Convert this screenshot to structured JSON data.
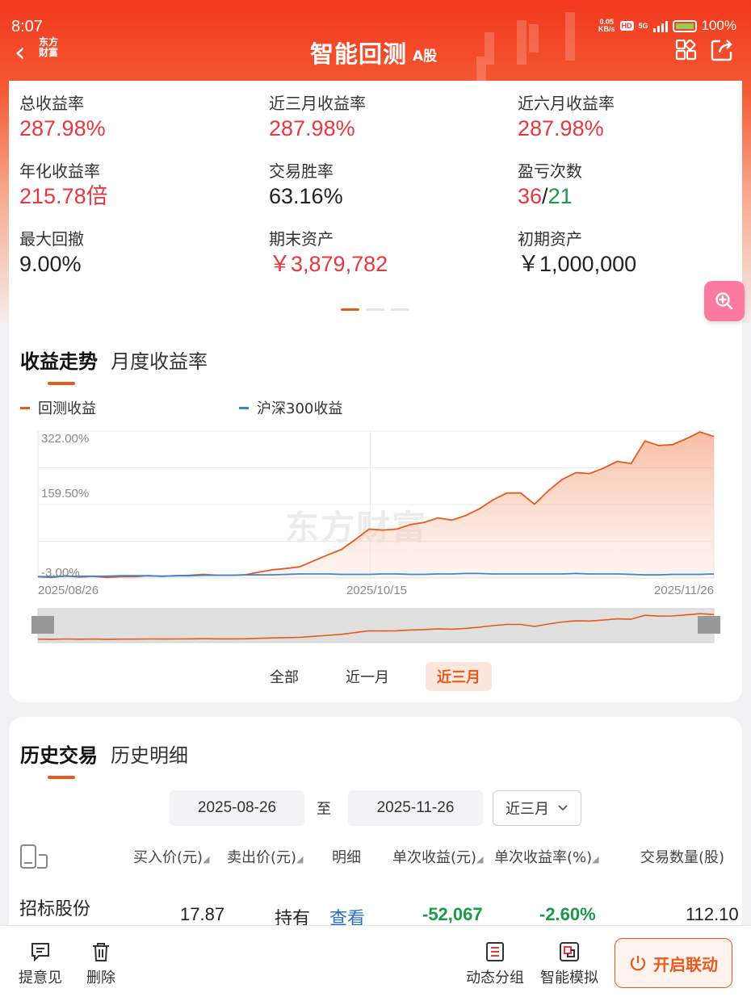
{
  "status_bar": {
    "time": "8:07",
    "net_speed_value": "0.05",
    "net_speed_unit": "KB/s",
    "hd": "HD",
    "network": "5G",
    "battery": "100%"
  },
  "nav": {
    "title": "智能回测",
    "subtitle": "A股",
    "logo_line1": "东方",
    "logo_line2": "财富",
    "back_icon": "chevron-left-icon",
    "grid_icon": "apps-grid-icon",
    "share_icon": "share-icon"
  },
  "stats": [
    {
      "label": "总收益率",
      "value": "287.98%"
    },
    {
      "label": "近三月收益率",
      "value": "287.98%"
    },
    {
      "label": "近六月收益率",
      "value": "287.98%"
    },
    {
      "label": "年化收益率",
      "value": "215.78倍"
    },
    {
      "label": "交易胜率",
      "value": "63.16%"
    },
    {
      "label": "盈亏次数",
      "value_win": "36",
      "sep": "/",
      "value_loss": "21"
    },
    {
      "label": "最大回撤",
      "value": "9.00%"
    },
    {
      "label": "期末资产",
      "value": "￥3,879,782"
    },
    {
      "label": "初期资产",
      "value": "￥1,000,000"
    }
  ],
  "colors": {
    "accent": "#e85a1c",
    "up": "#e8383d",
    "down": "#1a9a48",
    "benchmark": "#3a86d0"
  },
  "chart_section": {
    "tabs": [
      "收益走势",
      "月度收益率"
    ],
    "legend": [
      "回测收益",
      "沪深300收益"
    ],
    "watermark": "东方财富",
    "range_buttons": [
      "全部",
      "近一月",
      "近三月"
    ],
    "range_selected": "近三月"
  },
  "chart_data": {
    "type": "line",
    "y_tick_labels": [
      "322.00%",
      "159.50%",
      "-3.00%"
    ],
    "ylim": [
      -3,
      322
    ],
    "x_tick_labels": [
      "2025/08/26",
      "2025/10/15",
      "2025/11/26"
    ],
    "series": [
      {
        "name": "回测收益",
        "color": "#e85a1c",
        "values": [
          0,
          -2,
          2,
          -1,
          1,
          -2,
          0,
          0,
          2,
          1,
          2,
          3,
          5,
          3,
          3,
          4,
          10,
          15,
          18,
          22,
          35,
          48,
          60,
          82,
          105,
          103,
          105,
          115,
          120,
          130,
          125,
          135,
          150,
          170,
          185,
          185,
          160,
          190,
          215,
          230,
          228,
          240,
          255,
          250,
          300,
          290,
          292,
          305,
          320,
          310
        ]
      },
      {
        "name": "沪深300收益",
        "color": "#3a86d0",
        "values": [
          0,
          0,
          1,
          1,
          1,
          1,
          2,
          2,
          2,
          1,
          2,
          2,
          3,
          3,
          3,
          4,
          4,
          4,
          5,
          6,
          6,
          6,
          5,
          5,
          5,
          6,
          6,
          5,
          5,
          6,
          6,
          7,
          7,
          6,
          6,
          6,
          6,
          6,
          6,
          7,
          6,
          6,
          6,
          5,
          4,
          4,
          5,
          5,
          5,
          6
        ]
      }
    ]
  },
  "history": {
    "tabs": [
      "历史交易",
      "历史明细"
    ],
    "date_from": "2025-08-26",
    "date_to_label": "至",
    "date_to": "2025-11-26",
    "period": "近三月",
    "columns": [
      "买入价(元)",
      "卖出价(元)",
      "明细",
      "单次收益(元)",
      "单次收益率(%)",
      "交易数量(股)"
    ],
    "rows": [
      {
        "name": "招标股份",
        "buy": "17.87",
        "sell": "持有",
        "detail": "查看",
        "profit": "-52,067",
        "rate": "-2.60%",
        "qty": "112.10"
      }
    ]
  },
  "bottom_bar": {
    "feedback": "提意见",
    "delete": "删除",
    "group": "动态分组",
    "simulate": "智能模拟",
    "link": "开启联动"
  }
}
